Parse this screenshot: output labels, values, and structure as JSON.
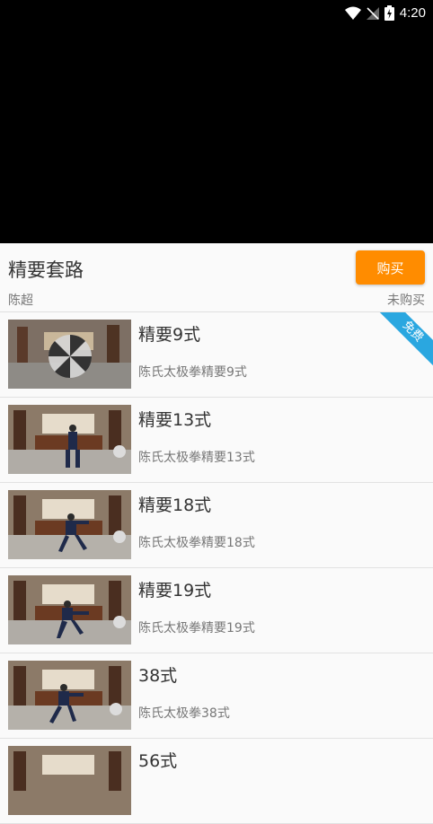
{
  "status_bar": {
    "time": "4:20"
  },
  "course": {
    "title": "精要套路",
    "buy_label": "购买",
    "instructor": "陈超",
    "purchase_status": "未购买"
  },
  "lessons": [
    {
      "title": "精要9式",
      "subtitle": "陈氏太极拳精要9式",
      "badge": "免费"
    },
    {
      "title": "精要13式",
      "subtitle": "陈氏太极拳精要13式"
    },
    {
      "title": "精要18式",
      "subtitle": "陈氏太极拳精要18式"
    },
    {
      "title": "精要19式",
      "subtitle": "陈氏太极拳精要19式"
    },
    {
      "title": "38式",
      "subtitle": "陈氏太极拳38式"
    },
    {
      "title": "56式",
      "subtitle": ""
    }
  ],
  "colors": {
    "buy": "#ff8c00",
    "badge": "#2aa7e0"
  }
}
